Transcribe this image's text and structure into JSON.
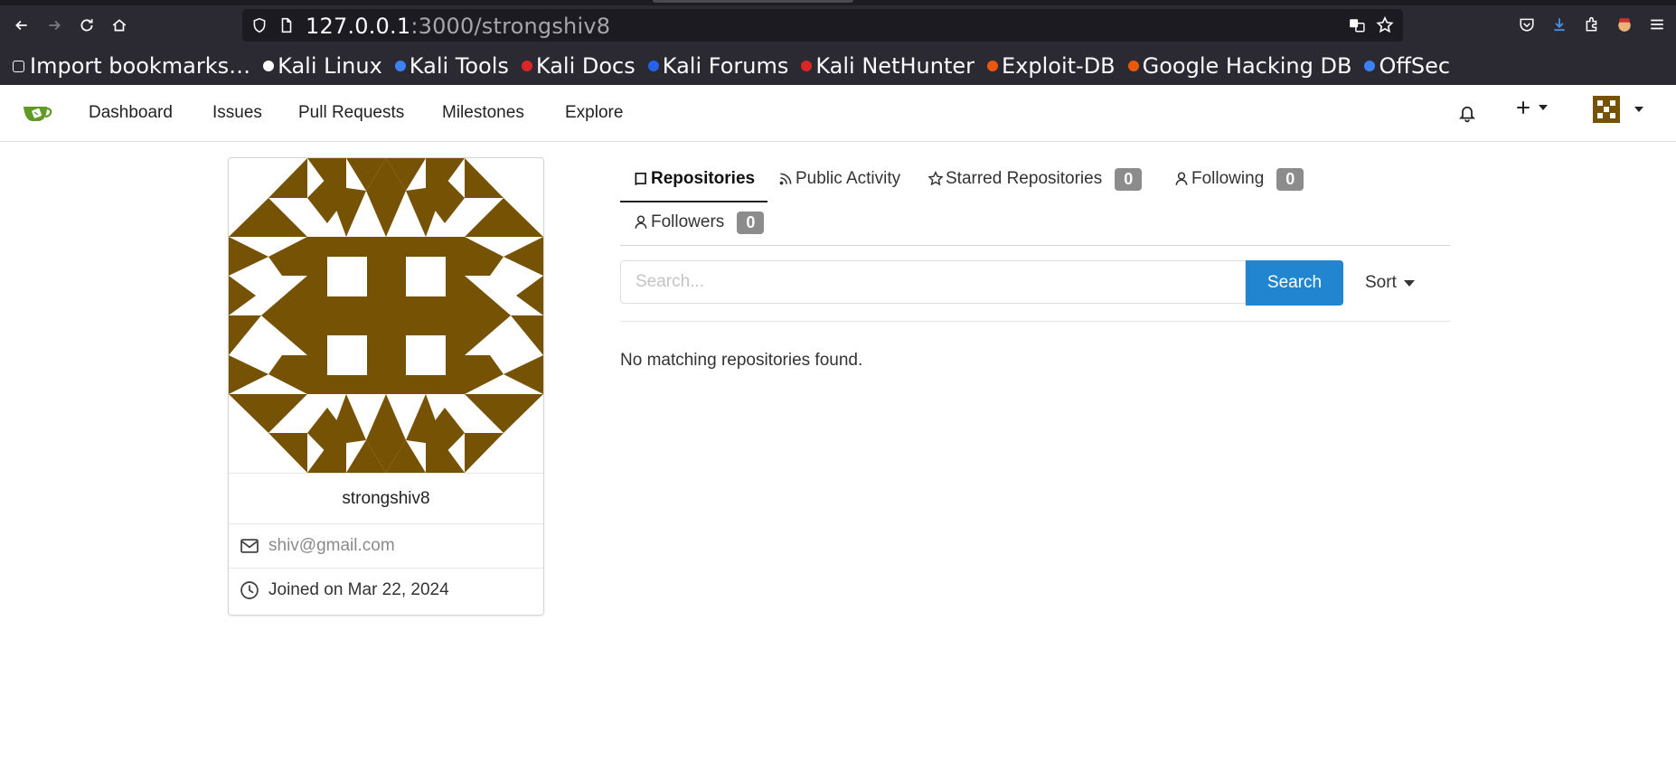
{
  "browser": {
    "url_host": "127.0.0.1",
    "url_rest": ":3000/strongshiv8",
    "bookmarks": [
      {
        "label": "Import bookmarks…",
        "icon": "import-icon",
        "color": "#fbfbfe"
      },
      {
        "label": "Kali Linux",
        "icon": "kali-dragon-icon",
        "color": "#ffffff"
      },
      {
        "label": "Kali Tools",
        "icon": "kali-tools-icon",
        "color": "#3b82f6"
      },
      {
        "label": "Kali Docs",
        "icon": "kali-docs-icon",
        "color": "#dc2626"
      },
      {
        "label": "Kali Forums",
        "icon": "kali-forums-icon",
        "color": "#2563eb"
      },
      {
        "label": "Kali NetHunter",
        "icon": "nethunter-icon",
        "color": "#dc2626"
      },
      {
        "label": "Exploit-DB",
        "icon": "exploit-db-icon",
        "color": "#ea580c"
      },
      {
        "label": "Google Hacking DB",
        "icon": "ghdb-icon",
        "color": "#ea580c"
      },
      {
        "label": "OffSec",
        "icon": "offsec-icon",
        "color": "#3b82f6"
      }
    ]
  },
  "nav": {
    "items": [
      "Dashboard",
      "Issues",
      "Pull Requests",
      "Milestones",
      "Explore"
    ],
    "logo_color": "#609926"
  },
  "profile": {
    "username": "strongshiv8",
    "email": "shiv@gmail.com",
    "joined": "Joined on Mar 22, 2024",
    "avatar_color": "#765205"
  },
  "tabs": {
    "repositories": "Repositories",
    "public_activity": "Public Activity",
    "starred": "Starred Repositories",
    "starred_count": "0",
    "following": "Following",
    "following_count": "0",
    "followers": "Followers",
    "followers_count": "0"
  },
  "search": {
    "placeholder": "Search...",
    "button": "Search",
    "sort": "Sort"
  },
  "empty_message": "No matching repositories found.",
  "colors": {
    "primary": "#2185d0",
    "badge": "#8c8c8c"
  }
}
